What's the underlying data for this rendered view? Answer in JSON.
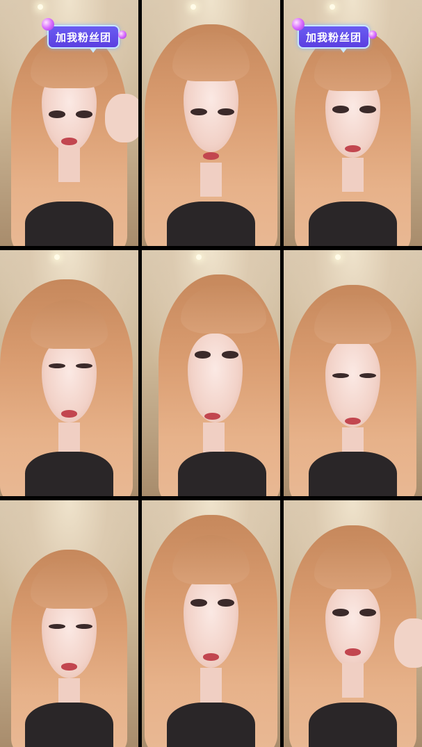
{
  "grid": {
    "tiles": [
      {
        "id": 1,
        "badge": true,
        "hand": "right"
      },
      {
        "id": 2,
        "badge": false,
        "hand": null
      },
      {
        "id": 3,
        "badge": true,
        "hand": null
      },
      {
        "id": 4,
        "badge": false,
        "hand": null
      },
      {
        "id": 5,
        "badge": false,
        "hand": null
      },
      {
        "id": 6,
        "badge": false,
        "hand": null
      },
      {
        "id": 7,
        "badge": false,
        "hand": null
      },
      {
        "id": 8,
        "badge": false,
        "hand": null
      },
      {
        "id": 9,
        "badge": false,
        "hand": "right"
      }
    ]
  },
  "badge": {
    "text": "加我粉丝团",
    "colors": {
      "fill": "#5b3fe0",
      "border": "#c9e7ff",
      "ornament": "#d86cff"
    }
  }
}
